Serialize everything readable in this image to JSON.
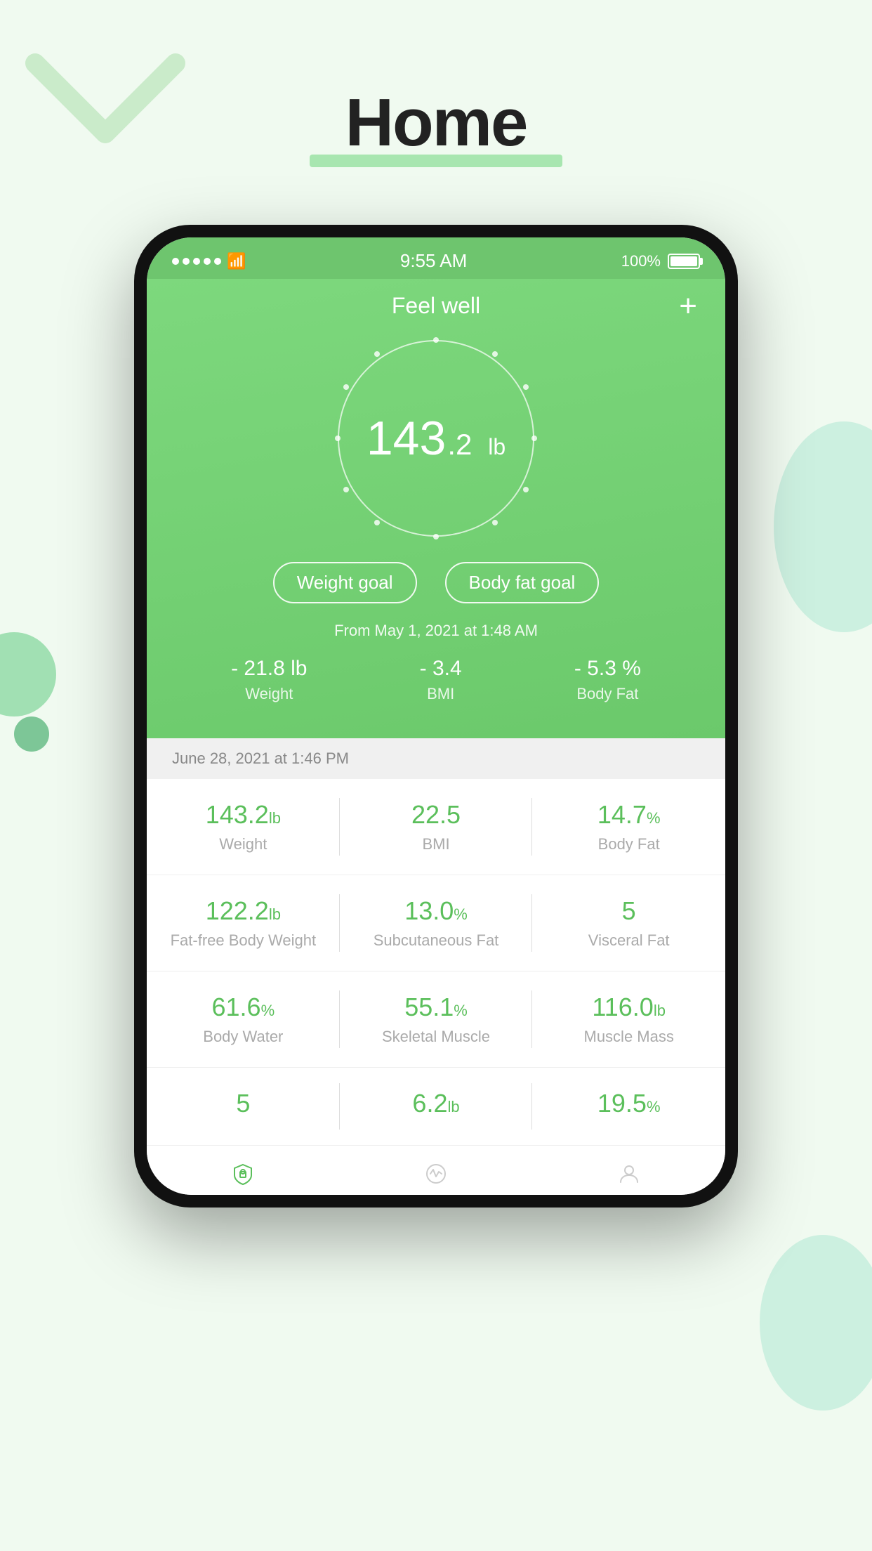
{
  "page": {
    "title": "Home",
    "title_underline_color": "#a8e6b0"
  },
  "status_bar": {
    "time": "9:55 AM",
    "battery_pct": "100%",
    "signal_dots": 5
  },
  "app_header": {
    "title": "Feel well",
    "add_button_label": "+"
  },
  "weight_display": {
    "value": "143",
    "decimal": ".2",
    "unit": "lb"
  },
  "goal_buttons": {
    "weight_goal": "Weight goal",
    "body_fat_goal": "Body fat goal"
  },
  "progress_section": {
    "from_label": "From May 1, 2021 at 1:48 AM",
    "stats": [
      {
        "value": "- 21.8",
        "unit": "lb",
        "label": "Weight"
      },
      {
        "value": "- 3.4",
        "unit": "",
        "label": "BMI"
      },
      {
        "value": "- 5.3",
        "unit": "%",
        "label": "Body Fat"
      }
    ]
  },
  "date_entry": {
    "date": "June 28, 2021 at 1:46 PM"
  },
  "metrics_rows": [
    [
      {
        "value": "143.2",
        "unit": "lb",
        "label": "Weight"
      },
      {
        "value": "22.5",
        "unit": "",
        "label": "BMI"
      },
      {
        "value": "14.7",
        "unit": "%",
        "label": "Body Fat"
      }
    ],
    [
      {
        "value": "122.2",
        "unit": "lb",
        "label": "Fat-free Body Weight"
      },
      {
        "value": "13.0",
        "unit": "%",
        "label": "Subcutaneous Fat"
      },
      {
        "value": "5",
        "unit": "",
        "label": "Visceral Fat"
      }
    ],
    [
      {
        "value": "61.6",
        "unit": "%",
        "label": "Body Water"
      },
      {
        "value": "55.1",
        "unit": "%",
        "label": "Skeletal Muscle"
      },
      {
        "value": "116.0",
        "unit": "lb",
        "label": "Muscle Mass"
      }
    ],
    [
      {
        "value": "5",
        "unit": "",
        "label": ""
      },
      {
        "value": "6.2",
        "unit": "lb",
        "label": ""
      },
      {
        "value": "19.5",
        "unit": "%",
        "label": ""
      }
    ]
  ],
  "bottom_nav": {
    "items": [
      {
        "icon": "shield",
        "label": ""
      },
      {
        "icon": "activity",
        "label": ""
      },
      {
        "icon": "person",
        "label": ""
      }
    ]
  },
  "circle_dots": [
    {
      "angle": 0
    },
    {
      "angle": 30
    },
    {
      "angle": 60
    },
    {
      "angle": 90
    },
    {
      "angle": 120
    },
    {
      "angle": 150
    },
    {
      "angle": 180
    },
    {
      "angle": 210
    },
    {
      "angle": 240
    },
    {
      "angle": 270
    },
    {
      "angle": 300
    },
    {
      "angle": 330
    }
  ]
}
